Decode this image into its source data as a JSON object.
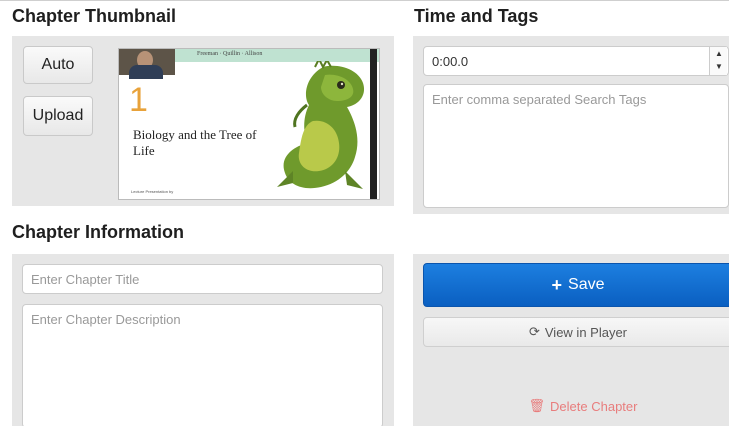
{
  "sections": {
    "thumbnail_heading": "Chapter Thumbnail",
    "time_tags_heading": "Time and Tags",
    "info_heading": "Chapter Information"
  },
  "thumbnail": {
    "auto_label": "Auto",
    "upload_label": "Upload",
    "slide": {
      "authors": "Freeman · Quillin · Allison",
      "number": "1",
      "title": "Biology and the Tree of Life",
      "credit": "Lecture Presentation by"
    }
  },
  "time_tags": {
    "time_value": "0:00.0",
    "tags_placeholder": "Enter comma separated Search Tags"
  },
  "info": {
    "title_placeholder": "Enter Chapter Title",
    "description_placeholder": "Enter Chapter Description"
  },
  "actions": {
    "save_label": "Save",
    "view_label": "View in Player",
    "delete_label": "Delete Chapter"
  },
  "icons": {
    "save": "plus-icon",
    "view": "refresh-icon",
    "delete": "trash-icon",
    "spinner_up": "chevron-up-icon",
    "spinner_down": "chevron-down-icon"
  },
  "colors": {
    "save_button": "#0a5fc1",
    "delete_text": "#e87d7d",
    "panel_bg": "#e6e6e6",
    "slide_number": "#e8a23a"
  }
}
